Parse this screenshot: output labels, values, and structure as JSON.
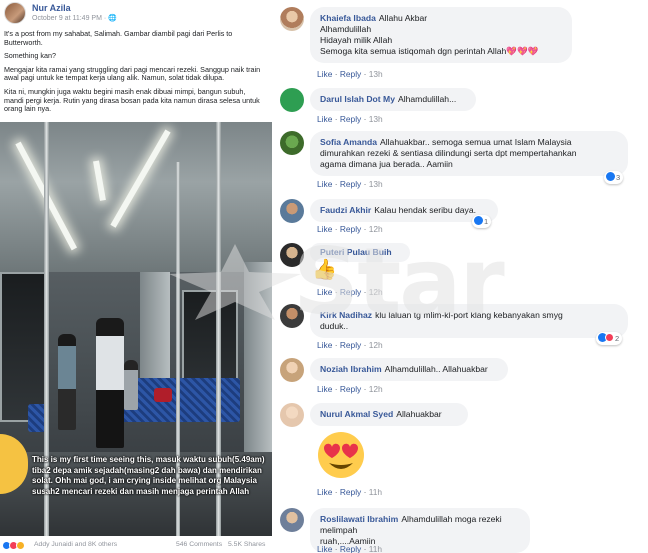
{
  "post": {
    "author": "Nur Azila",
    "timestamp": "October 9 at 11:49 PM · ",
    "paragraphs": [
      "It's a post from my sahabat, Salimah. Gambar diambil pagi dari Perlis to Butterworth.",
      "Something kan?",
      "Mengajar kita ramai yang struggling dari pagi mencari rezeki. Sanggup naik train awal pagi untuk ke tempat kerja ulang alik. Namun, solat tidak dilupa.",
      "Kita ni, mungkin juga waktu begini masih enak dibuai mimpi, bangun subuh, mandi pergi kerja. Rutin yang dirasa bosan pada kita namun dirasa selesa untuk orang lain nya."
    ],
    "photo_caption": "This is my first time seeing this, masuk waktu subuh(5.49am) tiba2 depa amik sejadah(masing2 dah bawa) dan mendirikan solat. Ohh mai god, i am crying inside melihat org Malaysia susah2 mencari rezeki dan masih menjaga perintah Allah",
    "footer": {
      "likers": "Addy Junaidi and 8K others",
      "comments": "546 Comments",
      "shares": "5.5K Shares"
    }
  },
  "actions": {
    "like": "Like",
    "reply": "Reply",
    "separator": "·"
  },
  "comments": [
    {
      "name": "Khaiefa Ibada",
      "text": "Allahu Akbar",
      "extra": [
        "Alhamdulillah",
        "Hidayah milik Allah",
        "Semoga kita semua istiqomah dgn perintah Allah💖💖💖"
      ],
      "time": "13h"
    },
    {
      "name": "Darul Islah Dot My",
      "text": "Alhamdulillah...",
      "time": "13h"
    },
    {
      "name": "Sofia Amanda",
      "text": "Allahuakbar.. semoga semua umat Islam Malaysia",
      "extra": [
        "dimurahkan rezeki & sentiasa dilindungi serta dpt mempertahankan",
        "agama dimana jua berada.. Aamiin"
      ],
      "time": "13h",
      "reactions": "3"
    },
    {
      "name": "Faudzi Akhir",
      "text": "Kalau hendak seribu daya.",
      "time": "12h",
      "reactions": "1"
    },
    {
      "name": "Puteri Pulau Buih",
      "text": "",
      "time": "12h"
    },
    {
      "name": "Kirk Nadihaz",
      "text": "klu laluan tg mlim-kl-port klang kebanyakan smyg",
      "extra": [
        "duduk.."
      ],
      "time": "12h",
      "reactions": "2"
    },
    {
      "name": "Noziah Ibrahim",
      "text": "Alhamdulillah.. Allahuakbar",
      "time": "12h"
    },
    {
      "name": "Nurul Akmal Syed",
      "text": "Allahuakbar",
      "time": "11h"
    },
    {
      "name": "Roslilawati Ibrahim",
      "text": "Alhamdulillah moga rezeki melimpah",
      "extra": [
        "ruah,....Aamiin"
      ],
      "time": "11h"
    }
  ],
  "watermark": "Star",
  "colors": {
    "link": "#385898",
    "bubble": "#f2f3f5",
    "muted": "#90949c"
  }
}
